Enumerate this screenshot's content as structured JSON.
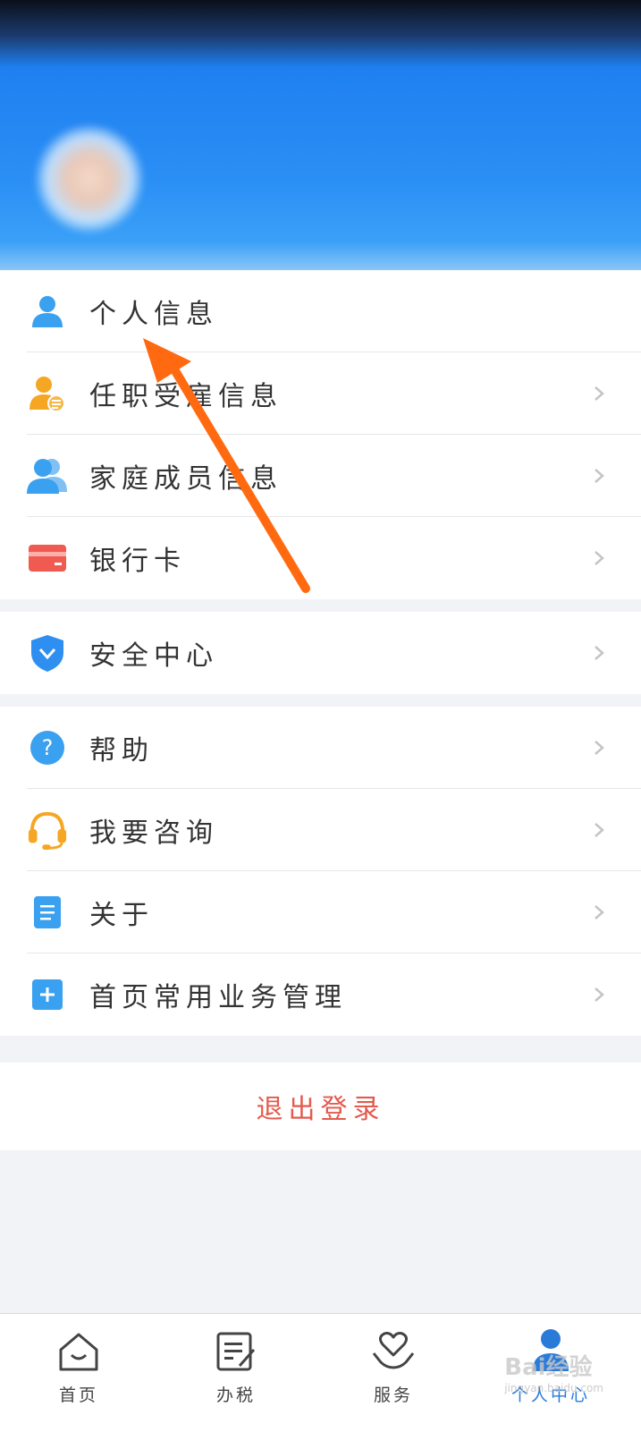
{
  "profile": {
    "menu_group_1": [
      {
        "label": "个人信息",
        "icon": "person-icon",
        "chevron": false
      },
      {
        "label": "任职受雇信息",
        "icon": "person-employment-icon",
        "chevron": true
      },
      {
        "label": "家庭成员信息",
        "icon": "family-icon",
        "chevron": true
      },
      {
        "label": "银行卡",
        "icon": "bank-card-icon",
        "chevron": true
      }
    ],
    "menu_group_2": [
      {
        "label": "安全中心",
        "icon": "shield-icon",
        "chevron": true
      }
    ],
    "menu_group_3": [
      {
        "label": "帮助",
        "icon": "help-icon",
        "chevron": true
      },
      {
        "label": "我要咨询",
        "icon": "headset-icon",
        "chevron": true
      },
      {
        "label": "关于",
        "icon": "document-icon",
        "chevron": true
      },
      {
        "label": "首页常用业务管理",
        "icon": "plus-icon",
        "chevron": true
      }
    ],
    "logout_label": "退出登录"
  },
  "tabbar": {
    "tabs": [
      {
        "label": "首页",
        "icon": "home-icon"
      },
      {
        "label": "办税",
        "icon": "tax-form-icon"
      },
      {
        "label": "服务",
        "icon": "heart-hands-icon"
      },
      {
        "label": "个人中心",
        "icon": "user-center-icon",
        "active": true
      }
    ]
  },
  "watermark": {
    "text": "Bai经验",
    "sub": "jingyan.baidu.com"
  },
  "colors": {
    "header_blue": "#2a8ff5",
    "accent_blue": "#2a7bd8",
    "logout_red": "#e35a4e",
    "arrow_orange": "#ff6a10"
  }
}
